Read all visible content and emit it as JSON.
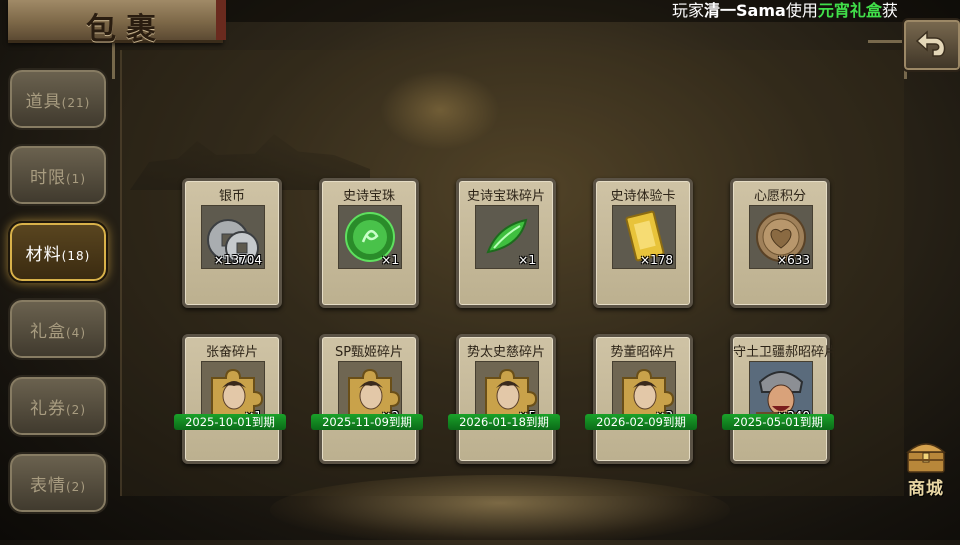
{
  "window": {
    "title": "包裹"
  },
  "ticker": {
    "prefix": "玩家",
    "player": "清一Sama",
    "middle": "使用",
    "gift": "元宵礼盒",
    "suffix": "获"
  },
  "back_button": {
    "icon": "back-arrow-icon"
  },
  "tabs": [
    {
      "label": "道具",
      "count": "(21)",
      "active": false
    },
    {
      "label": "时限",
      "count": "(1)",
      "active": false
    },
    {
      "label": "材料",
      "count": "(18)",
      "active": true
    },
    {
      "label": "礼盒",
      "count": "(4)",
      "active": false
    },
    {
      "label": "礼券",
      "count": "(2)",
      "active": false
    },
    {
      "label": "表情",
      "count": "(2)",
      "active": false
    }
  ],
  "items": [
    {
      "name": "银币",
      "qty": "×13704",
      "icon": "silver-coins-icon"
    },
    {
      "name": "史诗宝珠",
      "qty": "×1",
      "icon": "green-orb-icon"
    },
    {
      "name": "史诗宝珠碎片",
      "qty": "×1",
      "icon": "green-shard-icon"
    },
    {
      "name": "史诗体验卡",
      "qty": "×178",
      "icon": "gold-card-icon"
    },
    {
      "name": "心愿积分",
      "qty": "×633",
      "icon": "heart-coin-icon"
    },
    {
      "name": "张奋碎片",
      "qty": "×1",
      "icon": "puzzle-portrait-icon",
      "expiry": "2025-10-01到期"
    },
    {
      "name": "SP甄姬碎片",
      "qty": "×2",
      "icon": "puzzle-portrait-icon",
      "expiry": "2025-11-09到期"
    },
    {
      "name": "势太史慈碎片",
      "qty": "×5",
      "icon": "puzzle-portrait-icon",
      "expiry": "2026-01-18到期"
    },
    {
      "name": "势董昭碎片",
      "qty": "×3",
      "icon": "puzzle-portrait-icon",
      "expiry": "2026-02-09到期"
    },
    {
      "name": "守土卫疆郝昭碎片",
      "qty": "×240",
      "icon": "warrior-portrait-icon",
      "expiry": "2025-05-01到期"
    }
  ],
  "shop": {
    "label": "商城",
    "icon": "treasure-chest-icon"
  },
  "colors": {
    "accent_gold": "#d9b24a",
    "expiry_green": "#1aa22a",
    "ticker_gift": "#41e04a"
  }
}
